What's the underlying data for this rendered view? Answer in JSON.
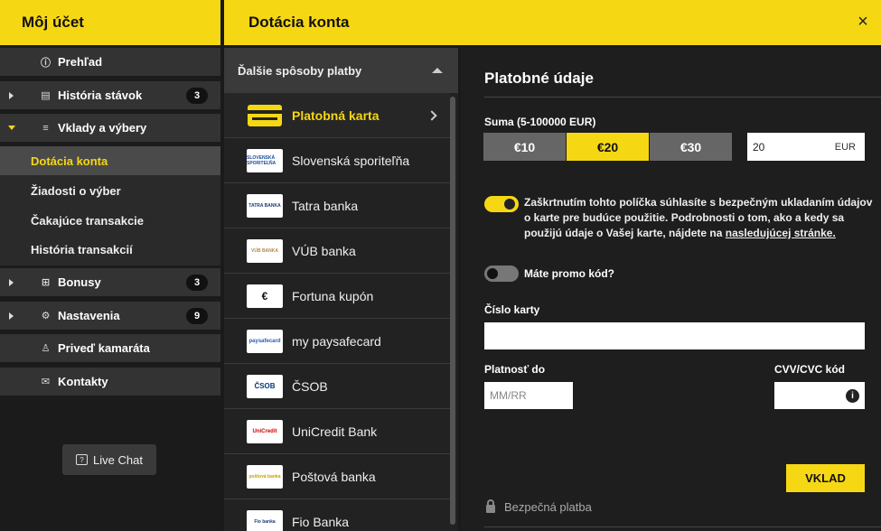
{
  "sidebar": {
    "title": "Môj účet",
    "items": [
      {
        "label": "Prehľad",
        "icon": "info-icon"
      },
      {
        "label": "História stávok",
        "icon": "history-icon",
        "badge": "3"
      },
      {
        "label": "Vklady a výbery",
        "icon": "coins-icon"
      },
      {
        "label": "Bonusy",
        "icon": "gift-icon",
        "badge": "3"
      },
      {
        "label": "Nastavenia",
        "icon": "gears-icon",
        "badge": "9"
      },
      {
        "label": "Priveď kamaráta",
        "icon": "user-icon"
      },
      {
        "label": "Kontakty",
        "icon": "mail-icon"
      }
    ],
    "subitems": [
      {
        "label": "Dotácia konta"
      },
      {
        "label": "Žiadosti o výber"
      },
      {
        "label": "Čakajúce transakcie"
      },
      {
        "label": "História transakcií"
      }
    ],
    "live_chat": "Live Chat"
  },
  "main": {
    "title": "Dotácia konta",
    "close": "×"
  },
  "payment_methods": {
    "header": "Ďalšie spôsoby platby",
    "items": [
      {
        "label": "Platobná karta",
        "logo": ""
      },
      {
        "label": "Slovenská sporiteľňa",
        "logo": "SLOVENSKÁ SPORITEĽŇA"
      },
      {
        "label": "Tatra banka",
        "logo": "TATRA BANKA"
      },
      {
        "label": "VÚB banka",
        "logo": "VÚB BANKA"
      },
      {
        "label": "Fortuna kupón",
        "logo": "€"
      },
      {
        "label": "my paysafecard",
        "logo": "paysafecard"
      },
      {
        "label": "ČSOB",
        "logo": "ČSOB"
      },
      {
        "label": "UniCredit Bank",
        "logo": "UniCredit"
      },
      {
        "label": "Poštová banka",
        "logo": "poštová banka"
      },
      {
        "label": "Fio Banka",
        "logo": "Fio banka"
      }
    ]
  },
  "form": {
    "title": "Platobné údaje",
    "amount_label": "Suma (5-100000 EUR)",
    "amounts": [
      "€10",
      "€20",
      "€30"
    ],
    "amount_value": "20",
    "currency": "EUR",
    "consent_text_1": "Zaškrtnutím tohto políčka súhlasíte s bezpečným ukladaním údajov o karte pre budúce použitie. Podrobnosti o tom, ako a kedy sa použijú údaje o Vašej karte, nájdete na ",
    "consent_link": "nasledujúcej stránke.",
    "promo_label": "Máte promo kód?",
    "card_number_label": "Číslo karty",
    "expiry_label": "Platnosť do",
    "expiry_placeholder": "MM/RR",
    "cvv_label": "CVV/CVC kód",
    "cvv_info": "i",
    "submit": "VKLAD",
    "secure": "Bezpečná platba"
  },
  "colors": {
    "accent": "#f6d714",
    "background": "#1e1e1e"
  }
}
